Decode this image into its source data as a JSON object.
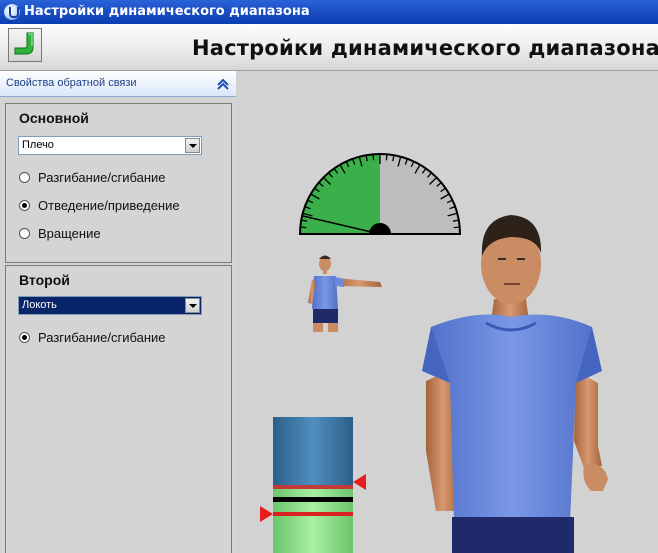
{
  "window": {
    "title": "Настройки динамического диапазона",
    "icon": "app-icon"
  },
  "header": {
    "title": "Настройки динамического диапазона",
    "button_icon": "arm-icon",
    "button_color": "#2fb33b"
  },
  "sidebar": {
    "feedback_section_label": "Свойства обратной связи",
    "collapse_icon": "chevron-up-icon",
    "primary": {
      "title": "Основной",
      "joint_value": "Плечо",
      "options": [
        {
          "label": "Разгибание/сгибание",
          "checked": false
        },
        {
          "label": "Отведение/приведение",
          "checked": true
        },
        {
          "label": "Вращение",
          "checked": false
        }
      ]
    },
    "secondary": {
      "title": "Второй",
      "joint_value": "Локоть",
      "options": [
        {
          "label": "Разгибание/сгибание",
          "checked": true
        }
      ]
    }
  },
  "viewport": {
    "gauge": {
      "green_color": "#3bb04a",
      "gray_color": "#bdbdbd"
    },
    "range_bar": {
      "top_color": "#3a78a8",
      "bottom_color": "#8fe08f",
      "marker_color": "#e81c1c"
    }
  }
}
